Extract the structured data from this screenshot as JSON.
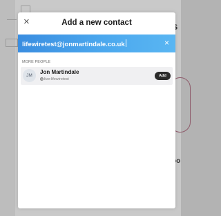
{
  "modal": {
    "title": "Add a new contact",
    "close_glyph": "×"
  },
  "search": {
    "value": "lifewiretest@jonmartindale.co.uk",
    "clear_glyph": "×"
  },
  "results": {
    "section_label": "MORE PEOPLE",
    "contacts": [
      {
        "initials": "JM",
        "name": "Jon Martindale",
        "handle": "live:lifewiretest",
        "handle_icon": "skype-icon",
        "add_label": "Add"
      }
    ]
  },
  "background": {
    "right_text_1": "s",
    "right_text_2": "po"
  },
  "colors": {
    "accent_start": "#3a8de0",
    "accent_end": "#5ab6f2",
    "add_button": "#2b2b2b"
  }
}
